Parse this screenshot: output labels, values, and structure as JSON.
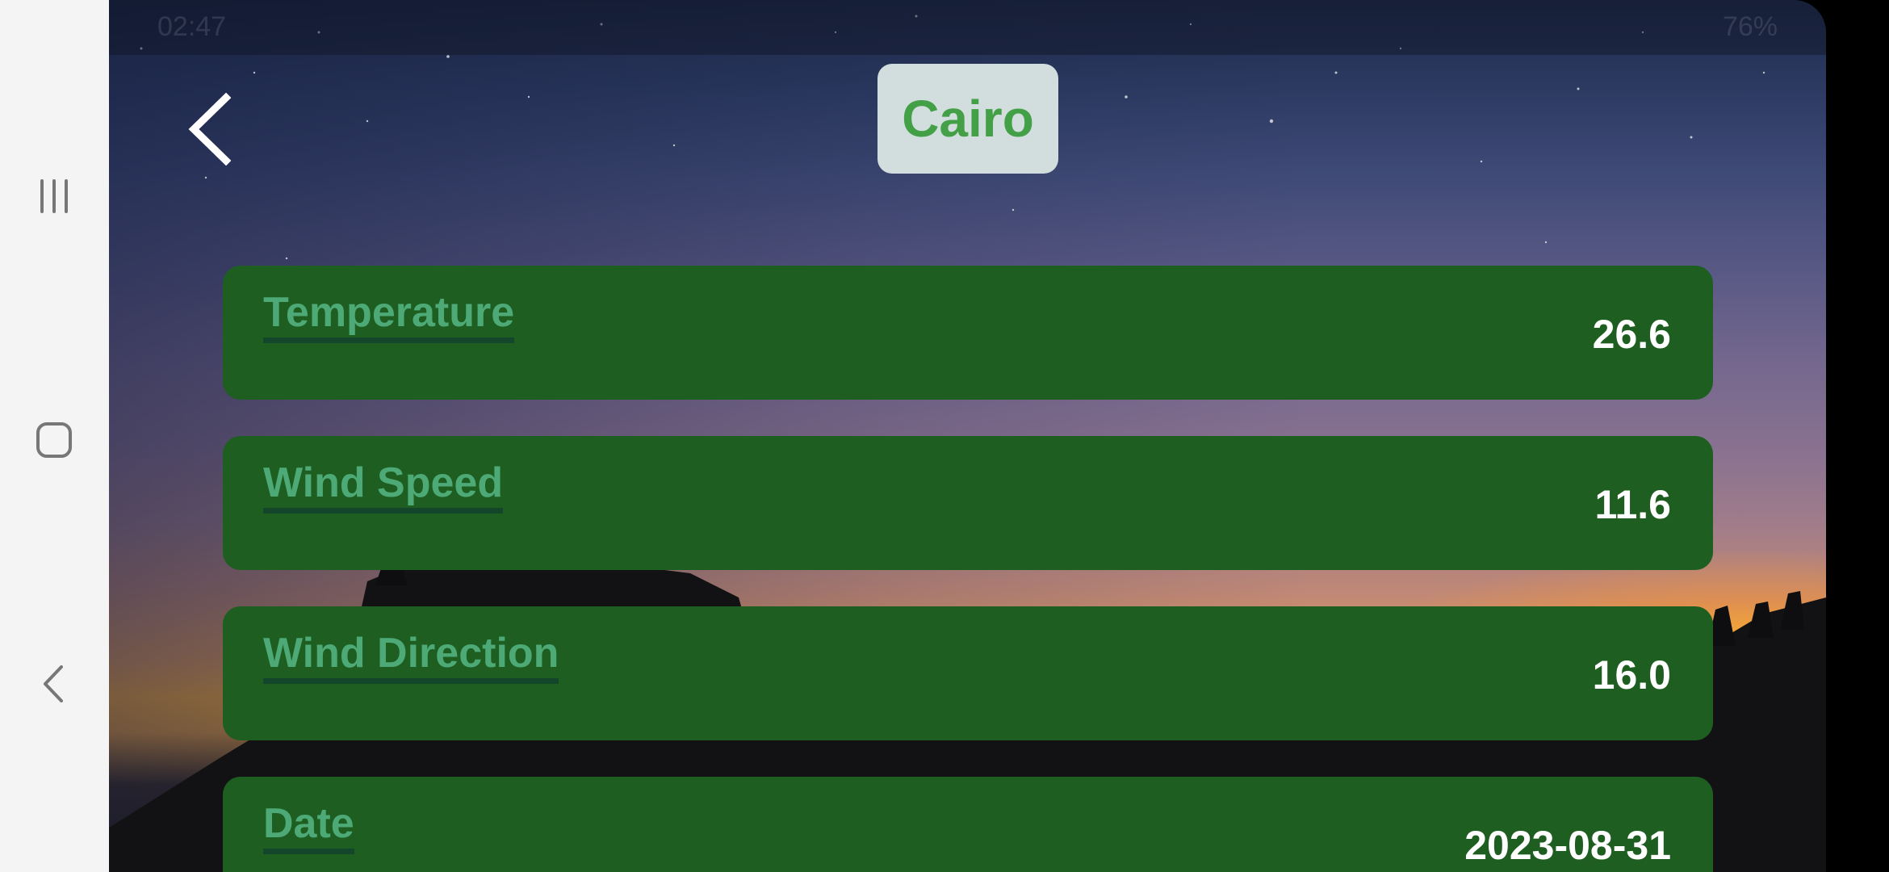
{
  "status_bar": {
    "time": "02:47",
    "battery": "76%"
  },
  "header": {
    "back_icon": "chevron-left-icon",
    "city": "Cairo"
  },
  "weather": {
    "items": [
      {
        "label": "Temperature",
        "value": "26.6"
      },
      {
        "label": "Wind Speed",
        "value": "11.6"
      },
      {
        "label": "Wind Direction",
        "value": "16.0"
      },
      {
        "label": "Date",
        "value": "2023-08-31"
      }
    ]
  },
  "navigation": {
    "recents_icon": "recents-icon",
    "home_icon": "home-icon",
    "back_icon": "back-icon"
  },
  "colors": {
    "card": "#1e5f21",
    "label": "#4daa77",
    "city_text": "#43a047",
    "city_chip": "#d1dedd"
  }
}
